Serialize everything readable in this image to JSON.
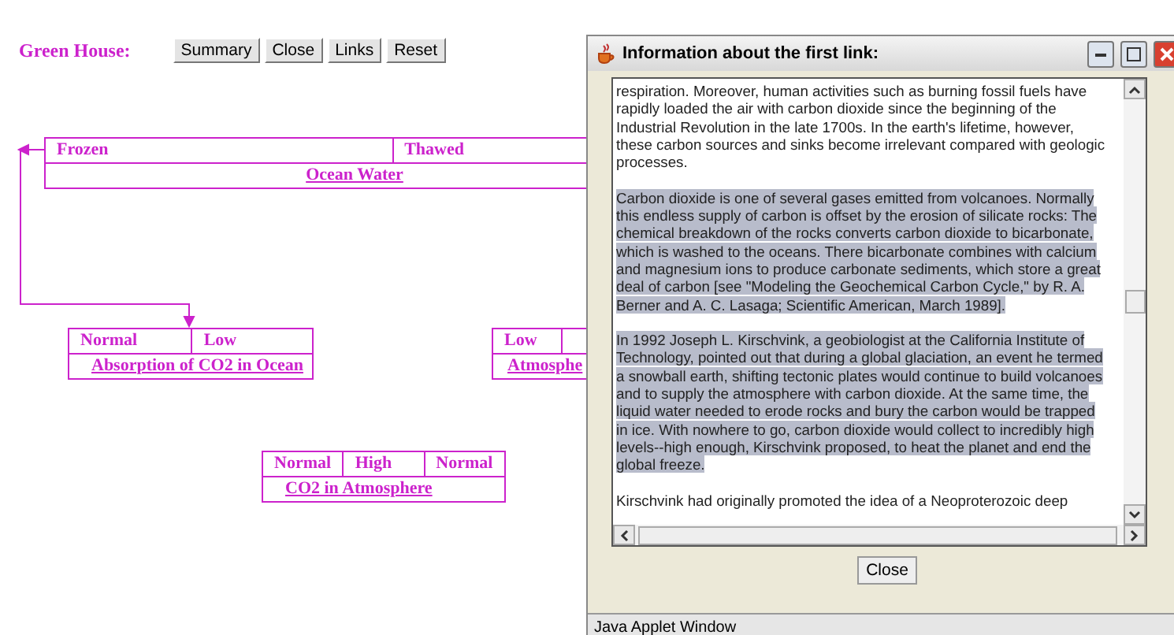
{
  "header": {
    "title": "Green House:",
    "buttons": [
      "Summary",
      "Close",
      "Links",
      "Reset"
    ]
  },
  "nodes": [
    {
      "states": [
        "Frozen",
        "Thawed"
      ],
      "name": "Ocean Water"
    },
    {
      "states": [
        "Normal",
        "Low"
      ],
      "name": "Absorption of CO2 in Ocean"
    },
    {
      "states": [
        "Low"
      ],
      "name": "Atmosphe"
    },
    {
      "states": [
        "Normal",
        "High",
        "Normal"
      ],
      "name": "CO2 in Atmosphere"
    }
  ],
  "dialog": {
    "title": "Information about the first link:",
    "paragraphs": [
      {
        "text": "respiration. Moreover, human activities such as burning fossil fuels have rapidly loaded the air with carbon dioxide since the beginning of the Industrial Revolution in the late 1700s. In the earth's lifetime, however, these carbon sources and sinks become irrelevant compared with geologic processes.",
        "selected": false
      },
      {
        "text": "Carbon dioxide is one of several gases emitted from volcanoes. Normally this endless supply of carbon is offset by the erosion of silicate rocks: The chemical breakdown of the rocks converts carbon dioxide to bicarbonate, which is washed to the oceans. There bicarbonate combines with calcium and magnesium ions to produce carbonate sediments, which store a great deal of carbon [see \"Modeling the Geochemical Carbon Cycle,\" by R. A. Berner and A. C. Lasaga; Scientific American, March 1989].",
        "selected": true
      },
      {
        "text": "In 1992 Joseph L. Kirschvink, a geobiologist at the California Institute of Technology, pointed out that during a global glaciation, an event he termed a snowball earth, shifting tectonic plates would continue to build volcanoes and to supply the atmosphere with carbon dioxide. At the same time, the liquid water needed to erode rocks and bury the carbon would be trapped in ice. With nowhere to go, carbon dioxide would collect to incredibly high levels--high enough, Kirschvink proposed, to heat the planet and end the global freeze.",
        "selected": true
      },
      {
        "text": "Kirschvink had originally promoted the idea of a Neoproterozoic deep",
        "selected": false
      }
    ],
    "button": "Close",
    "status": "Java Applet Window"
  }
}
